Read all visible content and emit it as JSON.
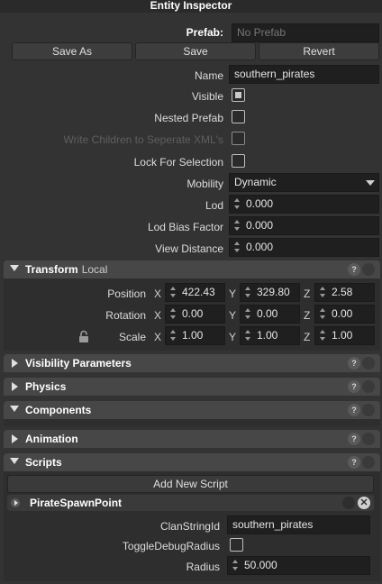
{
  "window": {
    "title": "Entity Inspector"
  },
  "prefab": {
    "label": "Prefab:",
    "placeholder": "No Prefab",
    "save_as": "Save As",
    "save": "Save",
    "revert": "Revert"
  },
  "props": {
    "name_label": "Name",
    "name_value": "southern_pirates",
    "visible_label": "Visible",
    "visible_checked": true,
    "nested_prefab_label": "Nested Prefab",
    "nested_prefab_checked": false,
    "write_children_label": "Write Children to Seperate XML's",
    "write_children_checked": false,
    "lock_selection_label": "Lock For Selection",
    "lock_selection_checked": false,
    "mobility_label": "Mobility",
    "mobility_value": "Dynamic",
    "lod_label": "Lod",
    "lod_value": "0.000",
    "lod_bias_label": "Lod Bias Factor",
    "lod_bias_value": "0.000",
    "view_distance_label": "View Distance",
    "view_distance_value": "0.000"
  },
  "transform": {
    "title": "Transform",
    "subtitle": "Local",
    "help": "?",
    "x": "X",
    "y": "Y",
    "z": "Z",
    "position_label": "Position",
    "position": [
      "422.43",
      "329.80",
      "2.58"
    ],
    "rotation_label": "Rotation",
    "rotation": [
      "0.00",
      "0.00",
      "0.00"
    ],
    "scale_label": "Scale",
    "scale": [
      "1.00",
      "1.00",
      "1.00"
    ]
  },
  "sections": {
    "visibility": "Visibility Parameters",
    "physics": "Physics",
    "components": "Components",
    "animation": "Animation",
    "scripts": "Scripts",
    "help": "?"
  },
  "scripts": {
    "add_button": "Add New Script",
    "script_name": "PirateSpawnPoint",
    "clan_label": "ClanStringId",
    "clan_value": "southern_pirates",
    "toggle_debug_label": "ToggleDebugRadius",
    "toggle_debug_checked": false,
    "radius_label": "Radius",
    "radius_value": "50.000"
  },
  "icons": [
    "lock-icon",
    "close-icon",
    "help-icon",
    "expand-arrow-icon",
    "collapse-arrow-icon",
    "spinner-icon",
    "dropdown-caret-icon"
  ]
}
